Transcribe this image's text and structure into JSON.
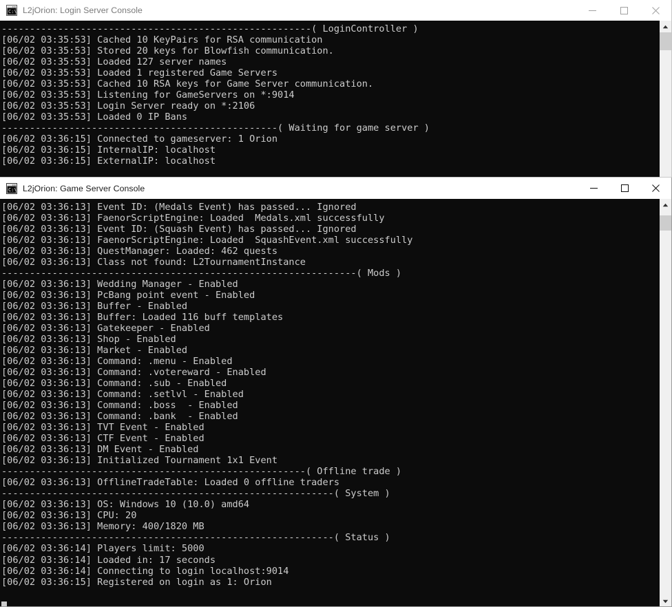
{
  "windows": [
    {
      "id": "login-server-console",
      "title": "L2jOrion: Login Server Console",
      "icon": "console-icon",
      "active": false,
      "controls": {
        "minimize": "Minimize",
        "maximize": "Maximize",
        "close": "Close"
      },
      "console_lines": [
        "-------------------------------------------------------( LoginController )",
        "[06/02 03:35:53] Cached 10 KeyPairs for RSA communication",
        "[06/02 03:35:53] Stored 20 keys for Blowfish communication.",
        "[06/02 03:35:53] Loaded 127 server names",
        "[06/02 03:35:53] Loaded 1 registered Game Servers",
        "[06/02 03:35:53] Cached 10 RSA keys for Game Server communication.",
        "[06/02 03:35:53] Listening for GameServers on *:9014",
        "[06/02 03:35:53] Login Server ready on *:2106",
        "[06/02 03:35:53] Loaded 0 IP Bans",
        "-------------------------------------------------( Waiting for game server )",
        "[06/02 03:36:15] Connected to gameserver: 1 Orion",
        "[06/02 03:36:15] InternalIP: localhost",
        "[06/02 03:36:15] ExternalIP: localhost"
      ]
    },
    {
      "id": "game-server-console",
      "title": "L2jOrion: Game Server Console",
      "icon": "console-icon",
      "active": true,
      "controls": {
        "minimize": "Minimize",
        "maximize": "Maximize",
        "close": "Close"
      },
      "console_lines": [
        "[06/02 03:36:13] Event ID: (Medals Event) has passed... Ignored",
        "[06/02 03:36:13] FaenorScriptEngine: Loaded  Medals.xml successfully",
        "[06/02 03:36:13] Event ID: (Squash Event) has passed... Ignored",
        "[06/02 03:36:13] FaenorScriptEngine: Loaded  SquashEvent.xml successfully",
        "[06/02 03:36:13] QuestManager: Loaded: 462 quests",
        "[06/02 03:36:13] Class not found: L2TournamentInstance",
        "---------------------------------------------------------------( Mods )",
        "[06/02 03:36:13] Wedding Manager - Enabled",
        "[06/02 03:36:13] PcBang point event - Enabled",
        "[06/02 03:36:13] Buffer - Enabled",
        "[06/02 03:36:13] Buffer: Loaded 116 buff templates",
        "[06/02 03:36:13] Gatekeeper - Enabled",
        "[06/02 03:36:13] Shop - Enabled",
        "[06/02 03:36:13] Market - Enabled",
        "[06/02 03:36:13] Command: .menu - Enabled",
        "[06/02 03:36:13] Command: .votereward - Enabled",
        "[06/02 03:36:13] Command: .sub - Enabled",
        "[06/02 03:36:13] Command: .setlvl - Enabled",
        "[06/02 03:36:13] Command: .boss  - Enabled",
        "[06/02 03:36:13] Command: .bank  - Enabled",
        "[06/02 03:36:13] TVT Event - Enabled",
        "[06/02 03:36:13] CTF Event - Enabled",
        "[06/02 03:36:13] DM Event - Enabled",
        "[06/02 03:36:13] Initialized Tournament 1x1 Event",
        "------------------------------------------------------( Offline trade )",
        "[06/02 03:36:13] OfflineTradeTable: Loaded 0 offline traders",
        "-----------------------------------------------------------( System )",
        "[06/02 03:36:13] OS: Windows 10 (10.0) amd64",
        "[06/02 03:36:13] CPU: 20",
        "[06/02 03:36:13] Memory: 400/1820 MB",
        "-----------------------------------------------------------( Status )",
        "[06/02 03:36:14] Players limit: 5000",
        "[06/02 03:36:14] Loaded in: 17 seconds",
        "[06/02 03:36:14] Connecting to login localhost:9014",
        "[06/02 03:36:15] Registered on login as 1: Orion"
      ],
      "caret": "block-cursor"
    }
  ],
  "theme": {
    "console_bg": "#0c0c0c",
    "console_fg": "#cccccc",
    "titlebar_bg": "#ffffff",
    "scrollbar_track": "#f0f0f0",
    "scrollbar_thumb": "#cdcdcd",
    "inactive_title_fg": "#7a7a7a",
    "active_title_fg": "#1b1b1b"
  }
}
